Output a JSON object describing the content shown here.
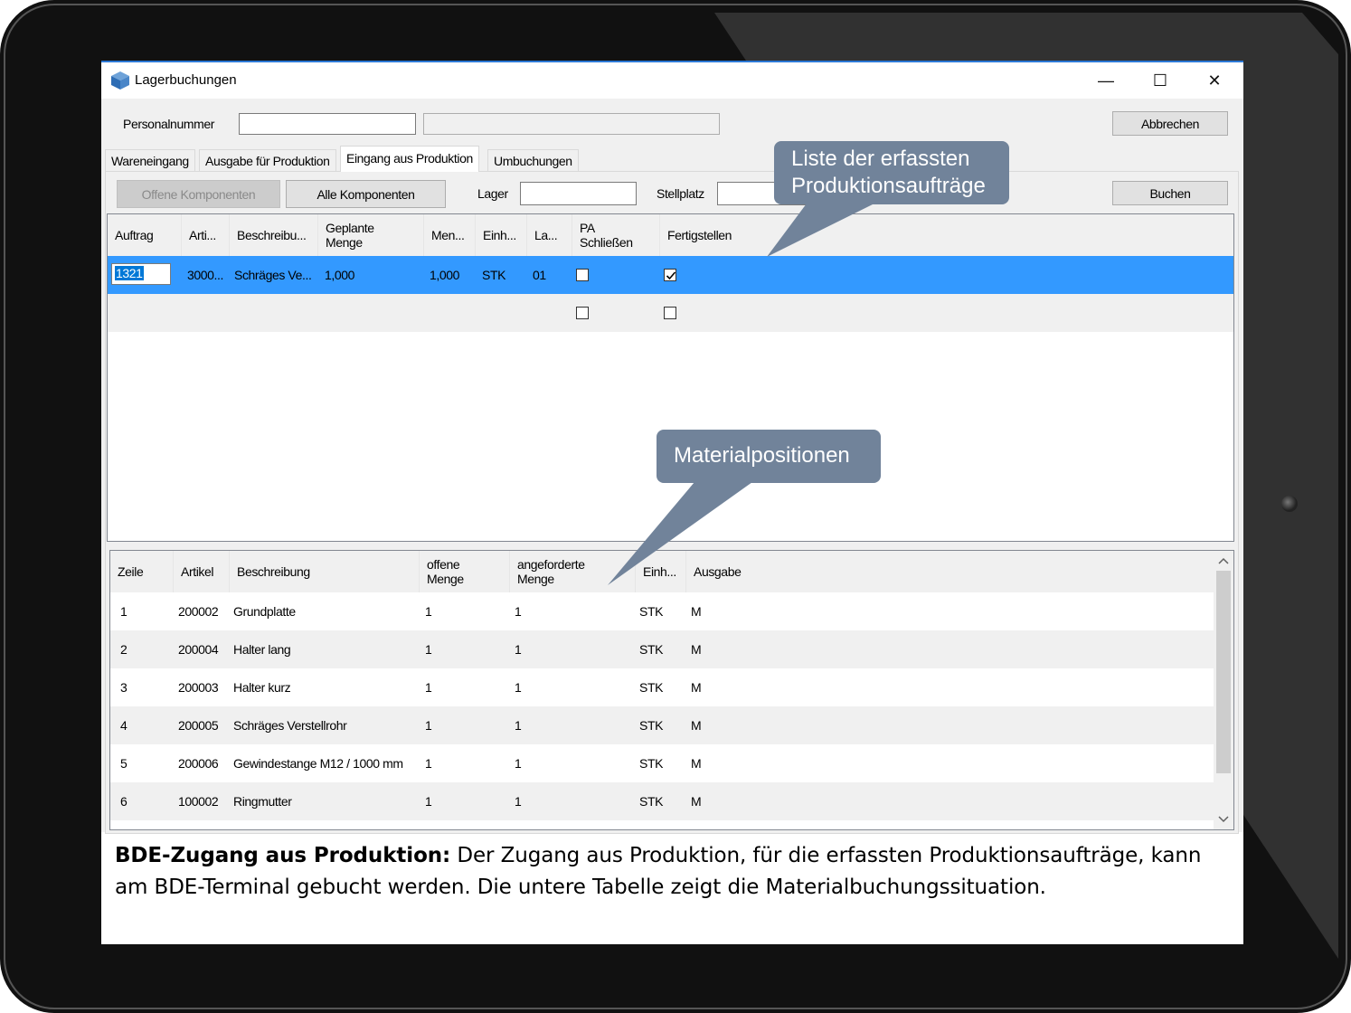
{
  "window": {
    "title": "Lagerbuchungen",
    "minimize": "—",
    "maximize": "☐",
    "close": "✕"
  },
  "form": {
    "personalnummer_label": "Personalnummer",
    "personalnummer_value": "",
    "personal_name_value": "",
    "abbrechen": "Abbrechen",
    "lager_label": "Lager",
    "lager_value": "",
    "stellplatz_label": "Stellplatz",
    "stellplatz_value": "",
    "buchen": "Buchen"
  },
  "tabs": [
    {
      "label": "Wareneingang"
    },
    {
      "label": "Ausgabe für Produktion"
    },
    {
      "label": "Eingang aus Produktion"
    },
    {
      "label": "Umbuchungen"
    }
  ],
  "buttons": {
    "offene": "Offene Komponenten",
    "alle": "Alle Komponenten"
  },
  "orders": {
    "headers": [
      "Auftrag",
      "Arti...",
      "Beschreibu...",
      "Geplante\nMenge",
      "Men...",
      "Einh...",
      "La...",
      "PA\nSchließen",
      "Fertigstellen"
    ],
    "rows": [
      {
        "auftrag": "1321",
        "artikel": "3000...",
        "beschreibung": "Schräges Ve...",
        "geplante_menge": "1,000",
        "menge": "1,000",
        "einheit": "STK",
        "lager": "01",
        "pa_schliessen": false,
        "fertigstellen": true
      },
      {
        "auftrag": "",
        "artikel": "",
        "beschreibung": "",
        "geplante_menge": "",
        "menge": "",
        "einheit": "",
        "lager": "",
        "pa_schliessen": false,
        "fertigstellen": false
      }
    ]
  },
  "materials": {
    "headers": [
      "Zeile",
      "Artikel",
      "Beschreibung",
      "offene\nMenge",
      "angeforderte\nMenge",
      "Einh...",
      "Ausgabe"
    ],
    "rows": [
      {
        "zeile": "1",
        "artikel": "200002",
        "beschreibung": "Grundplatte",
        "offen": "1",
        "angefordert": "1",
        "einheit": "STK",
        "ausgabe": "M"
      },
      {
        "zeile": "2",
        "artikel": "200004",
        "beschreibung": "Halter lang",
        "offen": "1",
        "angefordert": "1",
        "einheit": "STK",
        "ausgabe": "M"
      },
      {
        "zeile": "3",
        "artikel": "200003",
        "beschreibung": "Halter kurz",
        "offen": "1",
        "angefordert": "1",
        "einheit": "STK",
        "ausgabe": "M"
      },
      {
        "zeile": "4",
        "artikel": "200005",
        "beschreibung": "Schräges Verstellrohr",
        "offen": "1",
        "angefordert": "1",
        "einheit": "STK",
        "ausgabe": "M"
      },
      {
        "zeile": "5",
        "artikel": "200006",
        "beschreibung": "Gewindestange M12 / 1000 mm",
        "offen": "1",
        "angefordert": "1",
        "einheit": "STK",
        "ausgabe": "M"
      },
      {
        "zeile": "6",
        "artikel": "100002",
        "beschreibung": "Ringmutter",
        "offen": "1",
        "angefordert": "1",
        "einheit": "STK",
        "ausgabe": "M"
      }
    ]
  },
  "callouts": {
    "orders": "Liste der erfassten\nProduktionsaufträge",
    "materials": "Materialpositionen"
  },
  "caption": {
    "bold": "BDE-Zugang aus Produktion:",
    "text": " Der Zugang aus Produktion, für die erfassten Produktionsaufträge, kann am BDE-Terminal gebucht werden. Die untere Tabelle zeigt die Materialbuchungssituation."
  },
  "colors": {
    "selection": "#3399ff",
    "callout": "#71839a",
    "titlebar_accent": "#2b78d6"
  }
}
